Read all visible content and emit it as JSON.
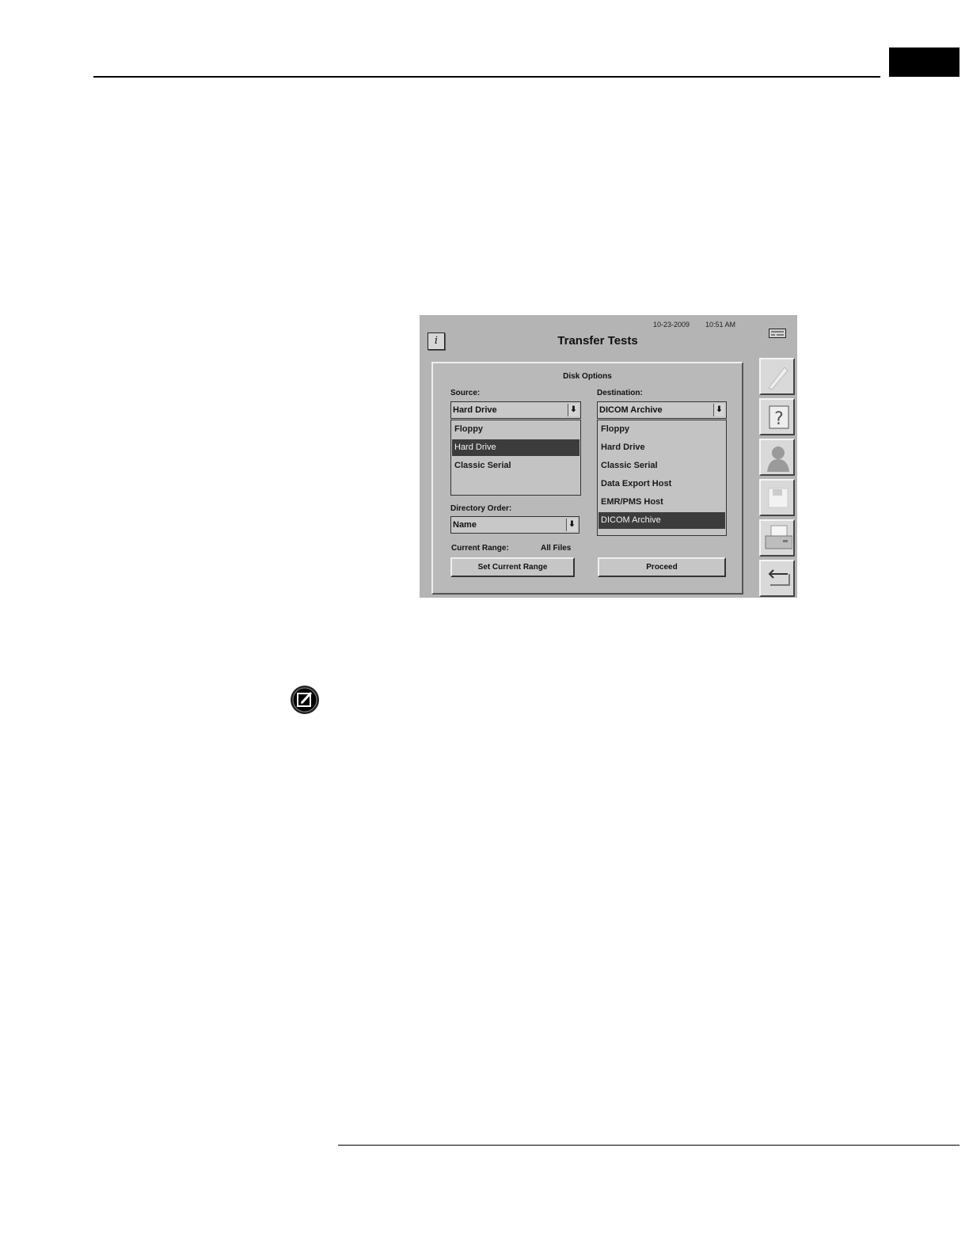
{
  "header": {
    "date": "10-23-2009",
    "time": "10:51 AM",
    "title": "Transfer Tests",
    "info_glyph": "i"
  },
  "panel": {
    "title": "Disk Options",
    "source": {
      "label": "Source:",
      "value": "Hard Drive",
      "options": [
        "Floppy",
        "Hard Drive",
        "Classic Serial"
      ],
      "selected": "Hard Drive"
    },
    "destination": {
      "label": "Destination:",
      "value": "DICOM Archive",
      "options": [
        "Floppy",
        "Hard Drive",
        "Classic Serial",
        "Data Export Host",
        "EMR/PMS Host",
        "DICOM Archive"
      ],
      "selected": "DICOM Archive"
    },
    "directory_order": {
      "label": "Directory Order:",
      "value": "Name"
    },
    "current_range": {
      "label": "Current Range:",
      "value": "All Files"
    },
    "buttons": {
      "set_range": "Set Current Range",
      "proceed": "Proceed"
    }
  },
  "sidebar": {
    "icons": [
      "pen-icon",
      "help-icon",
      "patient-icon",
      "disk-icon",
      "printer-icon",
      "return-icon"
    ]
  },
  "colors": {
    "window_bg": "#b4b4b4",
    "selected_row": "#3c3c3c"
  }
}
